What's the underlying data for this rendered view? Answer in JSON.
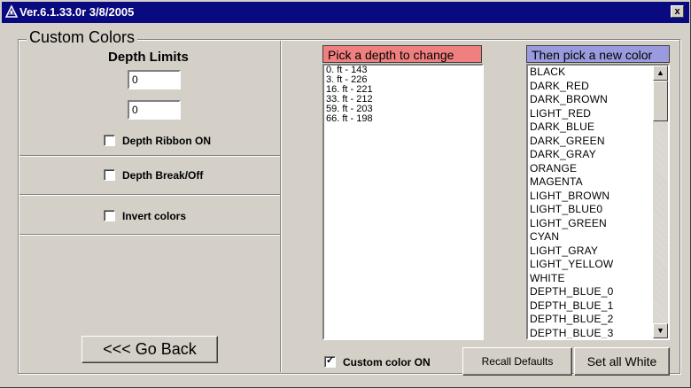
{
  "window": {
    "title": "Ver.6.1.33.0r 3/8/2005",
    "close_label": "x"
  },
  "group": {
    "label": "Custom Colors"
  },
  "left": {
    "depth_limits_label": "Depth Limits",
    "depth_min": "0",
    "depth_max": "0",
    "ribbon": {
      "label": "Depth Ribbon ON",
      "checked": false
    },
    "break": {
      "label": "Depth Break/Off",
      "checked": false
    },
    "invert": {
      "label": "Invert colors",
      "checked": false
    },
    "go_back_label": "<<< Go Back"
  },
  "depth_picker": {
    "header": "Pick a depth to change",
    "header_color": "#f08080",
    "items": [
      "0. ft - 143",
      "3. ft - 226",
      "16. ft - 221",
      "33. ft - 212",
      "59. ft - 203",
      "66. ft - 198"
    ]
  },
  "color_picker": {
    "header": "Then pick a new color",
    "header_color": "#9a9ade",
    "items": [
      "BLACK",
      "DARK_RED",
      "DARK_BROWN",
      "LIGHT_RED",
      "DARK_BLUE",
      "DARK_GREEN",
      "DARK_GRAY",
      "ORANGE",
      "MAGENTA",
      "LIGHT_BROWN",
      "LIGHT_BLUE0",
      "LIGHT_GREEN",
      "CYAN",
      "LIGHT_GRAY",
      "LIGHT_YELLOW",
      "WHITE",
      "DEPTH_BLUE_0",
      "DEPTH_BLUE_1",
      "DEPTH_BLUE_2",
      "DEPTH_BLUE_3"
    ]
  },
  "bottom": {
    "custom_color": {
      "label": "Custom color ON",
      "checked": true
    },
    "recall_label": "Recall Defaults",
    "set_white_label": "Set all White"
  },
  "icons": {
    "app": "app-logo-icon",
    "scroll_up": "arrow-up-icon",
    "scroll_down": "arrow-down-icon"
  }
}
